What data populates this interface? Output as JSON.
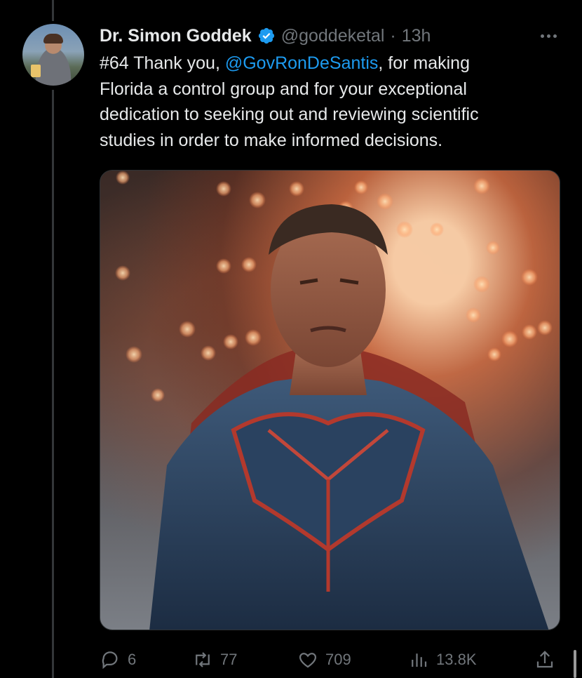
{
  "tweet": {
    "author_name": "Dr. Simon Goddek",
    "handle": "@goddeketal",
    "separator": "·",
    "time": "13h",
    "text_before": "#64 Thank you, ",
    "mention": "@GovRonDeSantis",
    "text_after": ", for making\nFlorida a control group and for your exceptional\ndedication to seeking out and reviewing scientific\nstudies in order to make informed decisions."
  },
  "actions": {
    "replies": "6",
    "retweets": "77",
    "likes": "709",
    "views": "13.8K"
  },
  "icons": {
    "verified": "verified-badge-icon",
    "more": "more-options-icon",
    "reply": "reply-icon",
    "retweet": "retweet-icon",
    "like": "heart-icon",
    "views": "views-chart-icon",
    "share": "share-icon"
  },
  "colors": {
    "background": "#000000",
    "text": "#e7e9ea",
    "muted": "#71767b",
    "accent": "#1d9bf0"
  }
}
